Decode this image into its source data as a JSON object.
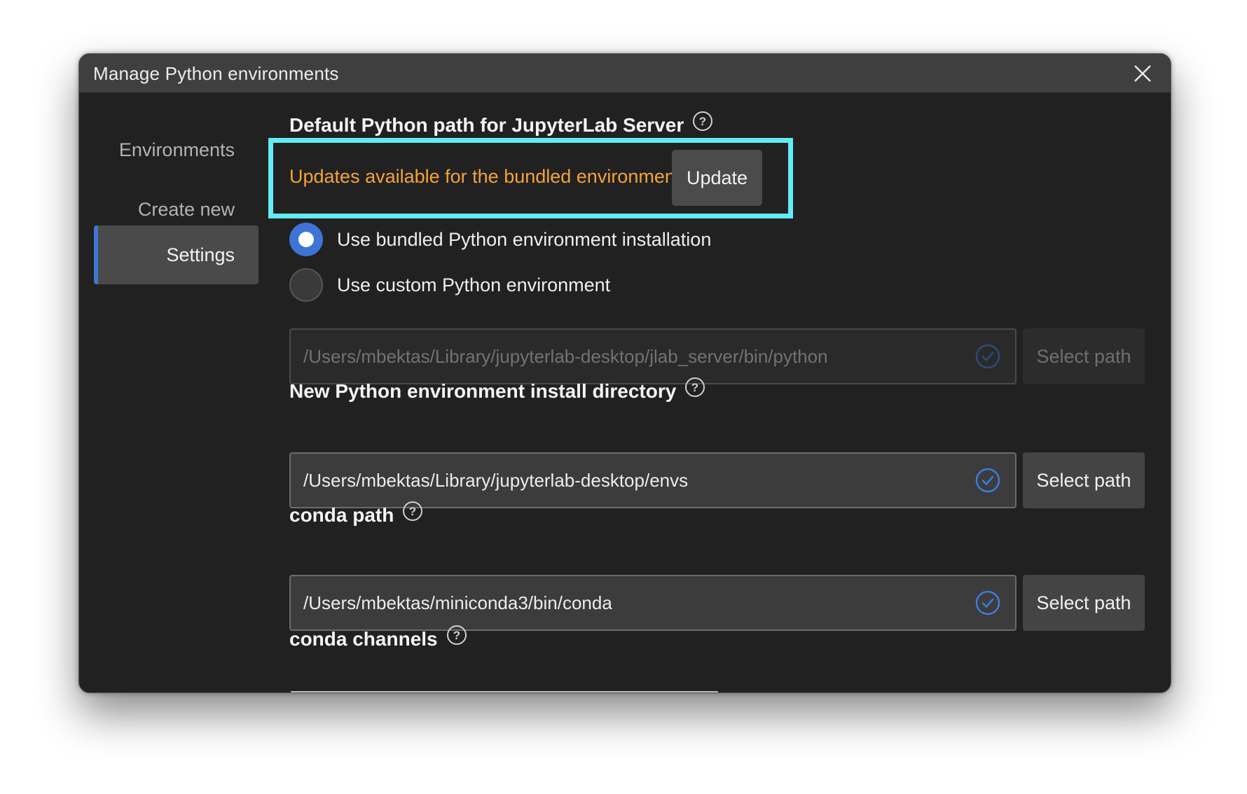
{
  "window": {
    "title": "Manage Python environments"
  },
  "sidebar": {
    "items": [
      {
        "label": "Environments",
        "active": false
      },
      {
        "label": "Create new",
        "active": false
      },
      {
        "label": "Settings",
        "active": true
      }
    ]
  },
  "settings": {
    "default_python": {
      "title": "Default Python path for JupyterLab Server",
      "update_message": "Updates available for the bundled environment",
      "update_button": "Update",
      "radio_bundled": "Use bundled Python environment installation",
      "radio_custom": "Use custom Python environment",
      "selected": "bundled",
      "path_value": "/Users/mbektas/Library/jupyterlab-desktop/jlab_server/bin/python",
      "select_path_label": "Select path"
    },
    "install_dir": {
      "title": "New Python environment install directory",
      "path_value": "/Users/mbektas/Library/jupyterlab-desktop/envs",
      "select_path_label": "Select path"
    },
    "conda_path": {
      "title": "conda path",
      "path_value": "/Users/mbektas/miniconda3/bin/conda",
      "select_path_label": "Select path"
    },
    "conda_channels": {
      "title": "conda channels"
    }
  },
  "colors": {
    "accent": "#3d77d6",
    "warning_text": "#f4a33a",
    "highlight_border": "#62ecf2",
    "valid_check": "#3d7be0"
  },
  "icons": [
    "close-icon",
    "help-icon",
    "check-circle-icon"
  ]
}
